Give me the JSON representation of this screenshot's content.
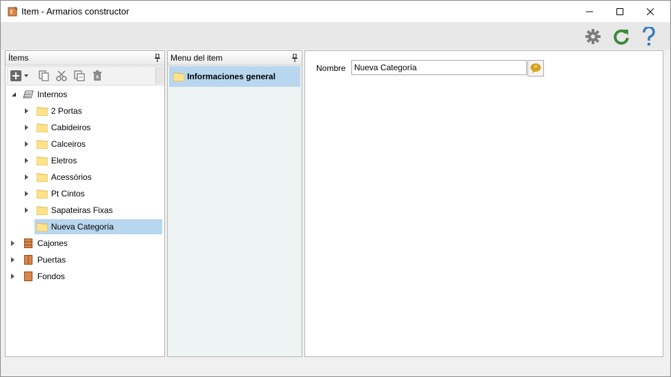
{
  "window": {
    "title": "Item - Armarios constructor"
  },
  "toolbar": {
    "buttons": [
      "gear-icon",
      "refresh-icon",
      "help-icon"
    ],
    "colors": {
      "gear": "#7d7d7d",
      "refresh": "#3c8a3c",
      "help": "#3b7bbf"
    }
  },
  "items_panel": {
    "title": "Ítems",
    "tree_tools": [
      "add-icon",
      "dropdown-icon",
      "copy-icon",
      "cut-icon",
      "paste-icon",
      "delete-icon"
    ],
    "tree": {
      "root": {
        "label": "Internos",
        "expanded": true
      },
      "children": [
        {
          "label": "2 Portas",
          "expandable": true
        },
        {
          "label": "Cabideiros",
          "expandable": true
        },
        {
          "label": "Calceiros",
          "expandable": true
        },
        {
          "label": "Eletros",
          "expandable": true
        },
        {
          "label": "Acessórios",
          "expandable": true
        },
        {
          "label": "Pt Cintos",
          "expandable": true
        },
        {
          "label": "Sapateiras Fixas",
          "expandable": true
        },
        {
          "label": "Nueva Categoría",
          "expandable": false,
          "selected": true
        }
      ],
      "siblings": [
        {
          "label": "Cajones",
          "icon": "drawer-icon"
        },
        {
          "label": "Puertas",
          "icon": "door-icon"
        },
        {
          "label": "Fondos",
          "icon": "panel-icon"
        }
      ]
    }
  },
  "menu_panel": {
    "title": "Menu del item",
    "items": [
      {
        "label": "Informaciones general",
        "selected": true
      }
    ]
  },
  "detail": {
    "nombre_label": "Nombre",
    "nombre_value": "Nueva Categoría"
  },
  "colors": {
    "selection": "#b8d7ef",
    "folder": "#ffe38a",
    "wood": "#d9874a"
  }
}
